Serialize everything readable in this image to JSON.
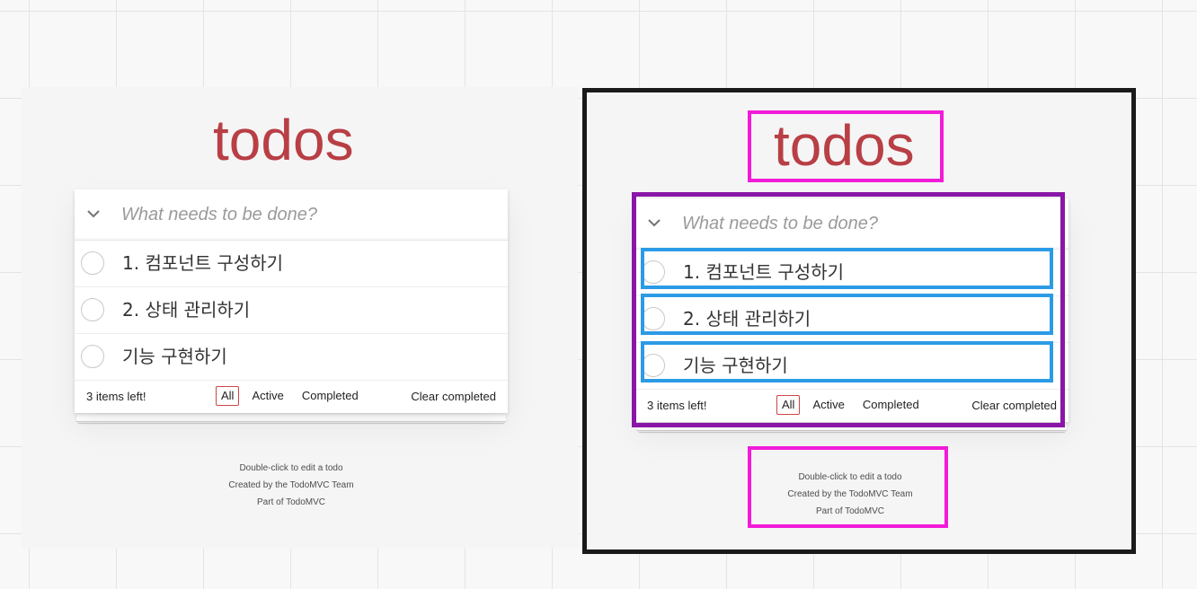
{
  "app": {
    "title": "todos",
    "new_todo_placeholder": "What needs to be done?"
  },
  "todos": [
    {
      "label": "1. 컴포넌트 구성하기",
      "completed": false
    },
    {
      "label": "2. 상태 관리하기",
      "completed": false
    },
    {
      "label": "기능 구현하기",
      "completed": false
    }
  ],
  "footer": {
    "items_left": "3 items left!",
    "filters": [
      "All",
      "Active",
      "Completed"
    ],
    "selected_filter": "All",
    "clear_completed": "Clear completed"
  },
  "info": {
    "line1": "Double-click to edit a todo",
    "line2": "Created by the TodoMVC Team",
    "line3": "Part of TodoMVC"
  },
  "colors": {
    "title": "#b83f45",
    "selected_filter_border": "#ce4646",
    "annotation_magenta": "#f21bd8",
    "annotation_purple": "#8a16a8",
    "annotation_blue": "#2b9be6",
    "frame": "#1a1a1a"
  },
  "icons": {
    "toggle_all": "chevron-down-icon",
    "todo_toggle": "circle-checkbox-icon"
  }
}
